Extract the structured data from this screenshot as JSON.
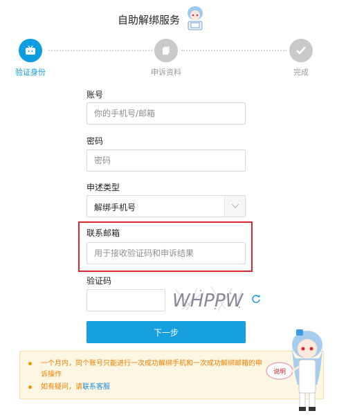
{
  "page": {
    "title": "自助解绑服务"
  },
  "steps": [
    {
      "label": "验证身份",
      "state": "active"
    },
    {
      "label": "申诉资料",
      "state": "todo"
    },
    {
      "label": "完成",
      "state": "todo"
    }
  ],
  "colors": {
    "accent": "#0d9de0",
    "inactive": "#c9c9c9",
    "warning_text": "#f08000",
    "highlight": "#d9262f"
  },
  "form": {
    "account": {
      "label": "账号",
      "placeholder": "你的手机号/邮箱"
    },
    "password": {
      "label": "密码",
      "placeholder": "密码"
    },
    "appeal_type": {
      "label": "申述类型",
      "value": "解绑手机号"
    },
    "contact_email": {
      "label": "联系邮箱",
      "placeholder": "用于接收验证码和申诉结果"
    },
    "captcha": {
      "label": "验证码",
      "image_text": "WHPPW"
    },
    "next_button": "下一步"
  },
  "notice": {
    "items": [
      {
        "text": "一个月内，同个账号只能进行一次成功解绑手机和一次成功解绑邮箱的申诉操作"
      },
      {
        "text_prefix": "如有疑问，请",
        "link": "联系客服"
      }
    ],
    "mascot_badge": "说明"
  }
}
